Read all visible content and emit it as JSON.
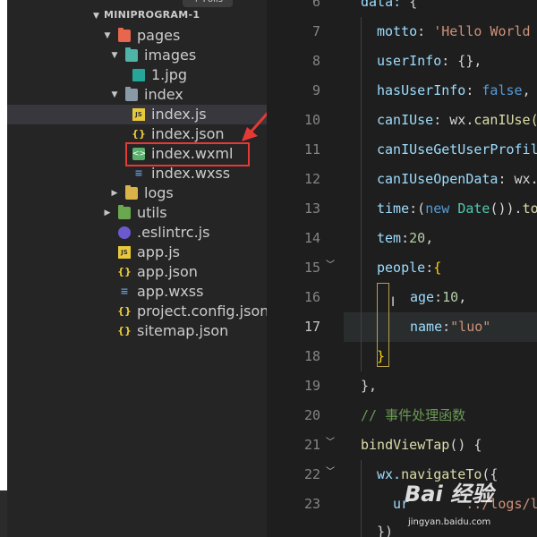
{
  "top_tab_label": "+ Folls",
  "explorer": {
    "section_title": "MINIPROGRAM-1",
    "items": [
      {
        "label": "pages",
        "icon": "folder-red-icon"
      },
      {
        "label": "images",
        "icon": "folder-teal-icon"
      },
      {
        "label": "1.jpg",
        "icon": "image-file-icon"
      },
      {
        "label": "index",
        "icon": "folder-icon"
      },
      {
        "label": "index.js",
        "icon": "js-file-icon"
      },
      {
        "label": "index.json",
        "icon": "json-file-icon"
      },
      {
        "label": "index.wxml",
        "icon": "wxml-file-icon"
      },
      {
        "label": "index.wxss",
        "icon": "wxss-file-icon"
      },
      {
        "label": "logs",
        "icon": "folder-yellow-icon"
      },
      {
        "label": "utils",
        "icon": "folder-green-icon"
      },
      {
        "label": ".eslintrc.js",
        "icon": "eslint-file-icon"
      },
      {
        "label": "app.js",
        "icon": "js-file-icon"
      },
      {
        "label": "app.json",
        "icon": "json-file-icon"
      },
      {
        "label": "app.wxss",
        "icon": "wxss-file-icon"
      },
      {
        "label": "project.config.json",
        "icon": "json-file-icon"
      },
      {
        "label": "sitemap.json",
        "icon": "json-file-icon"
      }
    ]
  },
  "editor": {
    "line_numbers": [
      "6",
      "7",
      "8",
      "9",
      "10",
      "11",
      "12",
      "13",
      "14",
      "15",
      "16",
      "17",
      "18",
      "19",
      "20",
      "21",
      "22",
      "23"
    ],
    "active_line": "17",
    "lines": {
      "l6": [
        "data: ",
        "{"
      ],
      "l7": [
        "motto",
        ": ",
        "'Hello World"
      ],
      "l8": [
        "userInfo",
        ": {},"
      ],
      "l9": [
        "hasUserInfo",
        ": ",
        "false",
        ","
      ],
      "l10": [
        "canIUse",
        ": wx.",
        "canIUse("
      ],
      "l11": [
        "canIUseGetUserProfil"
      ],
      "l12": [
        "canIUseOpenData",
        ": wx."
      ],
      "l13": [
        "time",
        ":(",
        "new ",
        "Date",
        "()).",
        "to"
      ],
      "l14": [
        "tem",
        ":",
        "20",
        ","
      ],
      "l15": [
        "people",
        ":",
        "{"
      ],
      "l16": [
        "age",
        ":",
        "10",
        ","
      ],
      "l17": [
        "name",
        ":",
        "\"luo\""
      ],
      "l18": [
        "}"
      ],
      "l19": [
        "},"
      ],
      "l20": [
        "// 事件处理函数"
      ],
      "l21": [
        "bindViewTap",
        "() {"
      ],
      "l22": [
        "wx.",
        "navigateTo",
        "({"
      ],
      "l23": [
        "ur",
        "../logs/logs"
      ],
      "l24": [
        "})"
      ]
    }
  },
  "watermark": {
    "brand": "Bai 经验",
    "url": "jingyan.baidu.com"
  }
}
